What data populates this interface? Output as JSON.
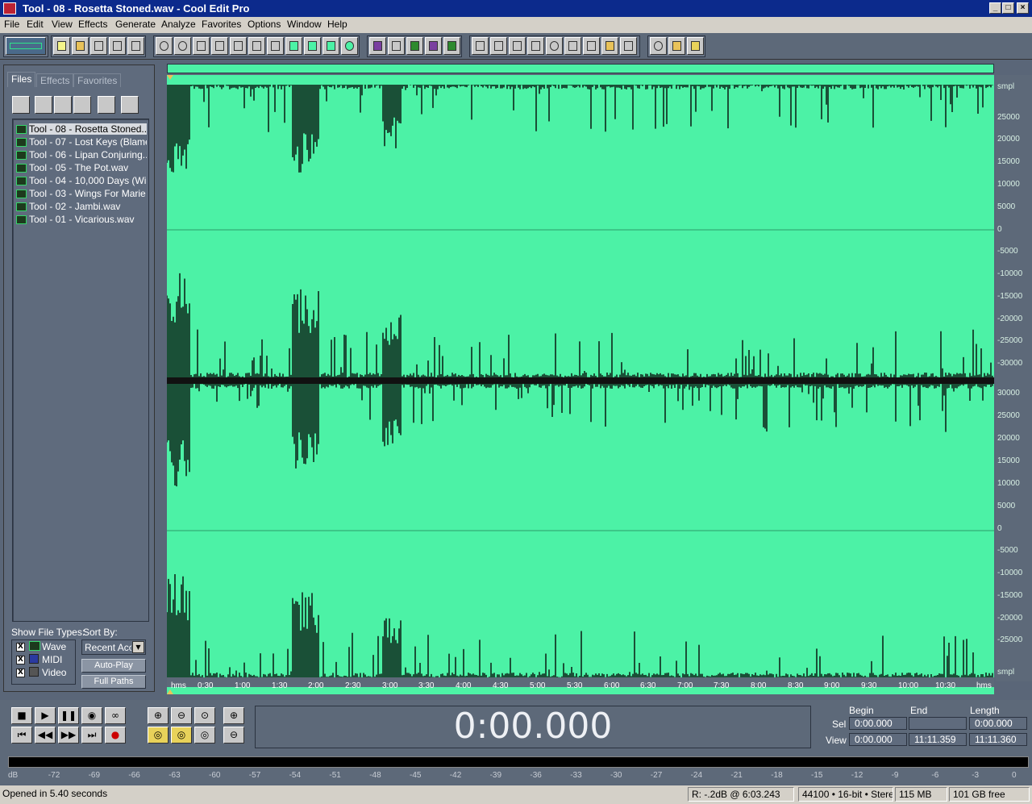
{
  "window": {
    "title": "Tool - 08 - Rosetta Stoned.wav - Cool Edit Pro",
    "min_label": "_",
    "max_label": "□",
    "close_label": "×"
  },
  "menu": [
    "File",
    "Edit",
    "View",
    "Effects",
    "Generate",
    "Analyze",
    "Favorites",
    "Options",
    "Window",
    "Help"
  ],
  "panel": {
    "tabs": [
      "Files",
      "Effects",
      "Favorites"
    ],
    "files": [
      "Tool - 08 - Rosetta Stoned....",
      "Tool - 07 - Lost Keys (Blame...",
      "Tool - 06 - Lipan Conjuring....",
      "Tool - 05 - The Pot.wav",
      "Tool - 04 - 10,000 Days (Wi...",
      "Tool - 03 - Wings For Marie ...",
      "Tool - 02 - Jambi.wav",
      "Tool - 01 - Vicarious.wav"
    ],
    "show_types_label": "Show File Types:",
    "sort_by_label": "Sort By:",
    "types": [
      {
        "label": "Wave",
        "checked": true
      },
      {
        "label": "MIDI",
        "checked": true
      },
      {
        "label": "Video",
        "checked": true
      }
    ],
    "sort_value": "Recent Acc",
    "autoplay_label": "Auto-Play",
    "fullpaths_label": "Full Paths"
  },
  "waveform": {
    "time_labels": [
      "hms",
      "0:30",
      "1:00",
      "1:30",
      "2:00",
      "2:30",
      "3:00",
      "3:30",
      "4:00",
      "4:30",
      "5:00",
      "5:30",
      "6:00",
      "6:30",
      "7:00",
      "7:30",
      "8:00",
      "8:30",
      "9:00",
      "9:30",
      "10:00",
      "10:30",
      "hms"
    ],
    "amp_top": [
      "smpl",
      "25000",
      "20000",
      "15000",
      "10000",
      "5000",
      "0",
      "-5000",
      "-10000",
      "-15000",
      "-20000",
      "-25000",
      "-30000"
    ],
    "amp_bottom": [
      "30000",
      "25000",
      "20000",
      "15000",
      "10000",
      "5000",
      "0",
      "-5000",
      "-10000",
      "-15000",
      "-20000",
      "-25000",
      "smpl"
    ],
    "background": "#4cf2a6"
  },
  "transport": {
    "time": "0:00.000",
    "headers": {
      "begin": "Begin",
      "end": "End",
      "length": "Length"
    },
    "sel": {
      "label": "Sel",
      "begin": "0:00.000",
      "end": "",
      "length": "0:00.000"
    },
    "view": {
      "label": "View",
      "begin": "0:00.000",
      "end": "11:11.359",
      "length": "11:11.360"
    }
  },
  "meter": {
    "ticks": [
      "dB",
      "-72",
      "-69",
      "-66",
      "-63",
      "-60",
      "-57",
      "-54",
      "-51",
      "-48",
      "-45",
      "-42",
      "-39",
      "-36",
      "-33",
      "-30",
      "-27",
      "-24",
      "-21",
      "-18",
      "-15",
      "-12",
      "-9",
      "-6",
      "-3",
      "0"
    ]
  },
  "status": {
    "message": "Opened in 5.40 seconds",
    "level": "R: -.2dB @  6:03.243",
    "format": "44100 • 16-bit • Stereo",
    "size": "115 MB",
    "free": "101 GB free"
  }
}
